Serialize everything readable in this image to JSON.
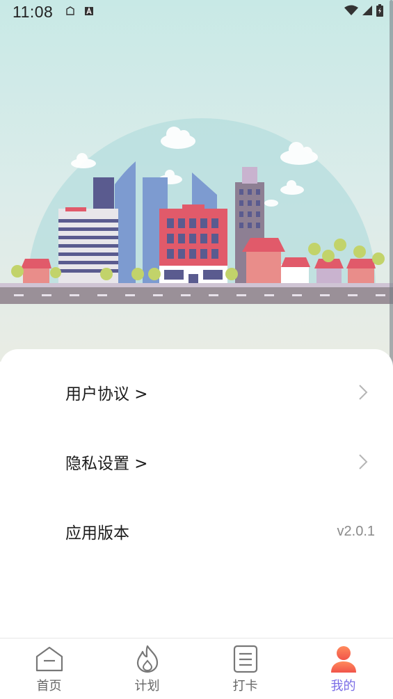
{
  "status_bar": {
    "time": "11:08"
  },
  "menu": {
    "items": [
      {
        "label": "用户协议 >",
        "has_chevron": true
      },
      {
        "label": "隐私设置 >",
        "has_chevron": true
      },
      {
        "label": "应用版本",
        "value": "v2.0.1"
      }
    ]
  },
  "tabbar": {
    "tabs": [
      {
        "label": "首页",
        "icon": "home-icon",
        "active": false
      },
      {
        "label": "计划",
        "icon": "flame-icon",
        "active": false
      },
      {
        "label": "打卡",
        "icon": "checklist-icon",
        "active": false
      },
      {
        "label": "我的",
        "icon": "profile-icon",
        "active": true
      }
    ]
  },
  "colors": {
    "accent": "#7a6de6",
    "profile_gradient_start": "#ff8a5c",
    "profile_gradient_end": "#f1544a"
  }
}
